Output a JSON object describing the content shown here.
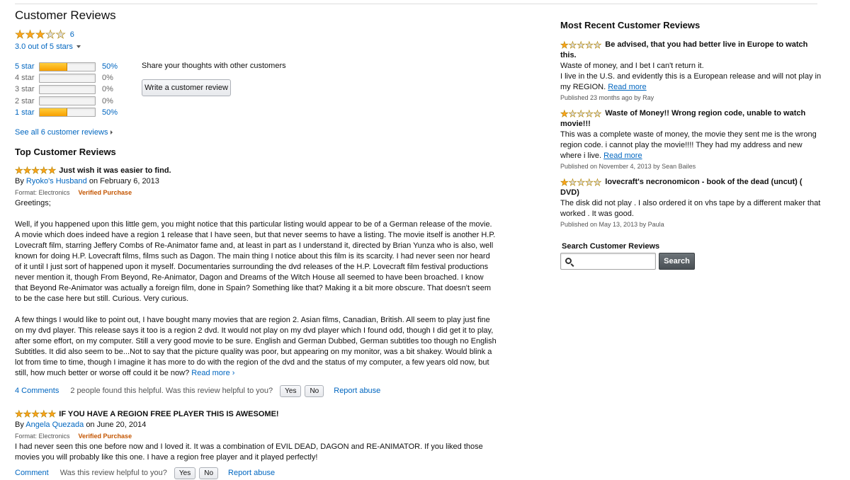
{
  "summary": {
    "title": "Customer Reviews",
    "stars": 3,
    "count": "6",
    "avg_label": "3.0 out of 5 stars",
    "histogram": [
      {
        "label": "5 star",
        "pct": "50%",
        "fraction": 0.5,
        "active": true
      },
      {
        "label": "4 star",
        "pct": "0%",
        "fraction": 0,
        "active": false
      },
      {
        "label": "3 star",
        "pct": "0%",
        "fraction": 0,
        "active": false
      },
      {
        "label": "2 star",
        "pct": "0%",
        "fraction": 0,
        "active": false
      },
      {
        "label": "1 star",
        "pct": "50%",
        "fraction": 0.5,
        "active": true
      }
    ],
    "share_text": "Share your thoughts with other customers",
    "write_button": "Write a customer review",
    "see_all": "See all 6 customer reviews"
  },
  "top_reviews": {
    "heading": "Top Customer Reviews",
    "items": [
      {
        "stars": 5,
        "title": "Just wish it was easier to find.",
        "by": "By",
        "author": "Ryoko's Husband",
        "date": "on February 6, 2013",
        "format": "Format: Electronics",
        "verified": "Verified Purchase",
        "body": "Greetings;\n\nWell, if you happened upon this little gem, you might notice that this particular listing would appear to be of a German release of the movie. A movie which does indeed have a region 1 release that I have seen, but that never seems to have a listing. The movie itself is another H.P. Lovecraft film, starring Jeffery Combs of Re-Animator fame and, at least in part as I understand it, directed by Brian Yunza who is also, well known for doing H.P. Lovecraft films, films such as Dagon. The main thing I notice about this film is its scarcity. I had never seen nor heard of it until I just sort of happened upon it myself. Documentaries surrounding the dvd releases of the H.P. Lovecraft film festival productions never mention it, though From Beyond, Re-Animator, Dagon and Dreams of the Witch House all seemed to have been broached. I know that Beyond Re-Animator was actually a foreign film, done in Spain? Something like that? Making it a bit more obscure. That doesn't seem to be the case here but still. Curious. Very curious.\n\nA few things I would like to point out, I have bought many movies that are region 2. Asian films, Canadian, British. All seem to play just fine on my dvd player. This release says it too is a region 2 dvd. It would not play on my dvd player which I found odd, though I did get it to play, after some effort, on my computer. Still a very good movie to be sure. English and German Dubbed, German subtitles too though no English Subtitles. It did also seem to be...Not to say that the picture quality was poor, but appearing on my monitor, was a bit shakey. Would blink a lot from time to time, though I imagine it has more to do with the region of the dvd and the status of my computer, a few years old now, but still, how much better or worse off could it be now?",
        "read_more": "Read more ›",
        "comments": "4 Comments",
        "helpful": "2 people found this helpful. Was this review helpful to you?",
        "yes": "Yes",
        "no": "No",
        "report": "Report abuse"
      },
      {
        "stars": 5,
        "title": "IF YOU HAVE A REGION FREE PLAYER THIS IS AWESOME!",
        "by": "By",
        "author": "Angela Quezada",
        "date": "on June 20, 2014",
        "format": "Format: Electronics",
        "verified": "Verified Purchase",
        "body": "I had never seen this one before now and I loved it. It was a combination of EVIL DEAD, DAGON and RE-ANIMATOR. If you liked those movies you will probably like this one. I have a region free player and it played perfectly!",
        "read_more": "",
        "comments": "Comment",
        "helpful": "Was this review helpful to you?",
        "yes": "Yes",
        "no": "No",
        "report": "Report abuse"
      }
    ]
  },
  "recent": {
    "heading": "Most Recent Customer Reviews",
    "items": [
      {
        "stars": 1,
        "title": "Be advised, that you had better live in Europe to watch this.",
        "text": "Waste of money, and I bet I can't return it.\nI live in the U.S. and evidently this is a European release and will not play in my REGION.",
        "read_more": "Read more",
        "published": "Published 23 months ago by Ray"
      },
      {
        "stars": 1,
        "title": "Waste of Money!! Wrong region code, unable to watch movie!!!",
        "text": "This was a complete waste of money, the movie they sent me is the wrong region code. i cannot play the movie!!!! They had my address and new where i live.",
        "read_more": "Read more",
        "published": "Published on November 4, 2013 by Sean Bailes"
      },
      {
        "stars": 1,
        "title": "lovecraft's necronomicon - book of the dead (uncut) ( DVD)",
        "text": "The disk did not play . I also ordered it on vhs tape by a different maker that worked . It was good.",
        "read_more": "",
        "published": "Published on May 13, 2013 by Paula"
      }
    ]
  },
  "search": {
    "label": "Search Customer Reviews",
    "placeholder": "",
    "button": "Search"
  },
  "colors": {
    "link": "#0066c0",
    "star": "#ffa41c",
    "verified": "#c45500",
    "bar_fill": "#f8a000"
  }
}
